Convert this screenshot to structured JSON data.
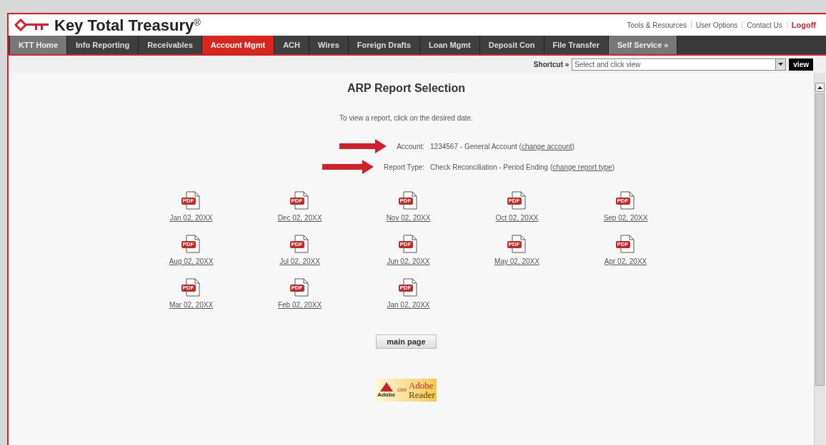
{
  "brand": {
    "name": "Key Total Treasury",
    "mark": "®"
  },
  "top_links": [
    {
      "label": "Tools & Resources",
      "kind": "link"
    },
    {
      "label": "User Options",
      "kind": "link"
    },
    {
      "label": "Contact Us",
      "kind": "link"
    },
    {
      "label": "Logoff",
      "kind": "logoff"
    }
  ],
  "tabs": [
    {
      "label": "KTT Home",
      "selected": false,
      "highlighted": true
    },
    {
      "label": "Info Reporting",
      "selected": false,
      "highlighted": false
    },
    {
      "label": "Receivables",
      "selected": false,
      "highlighted": false
    },
    {
      "label": "Account Mgmt",
      "selected": true,
      "highlighted": false
    },
    {
      "label": "ACH",
      "selected": false,
      "highlighted": false
    },
    {
      "label": "Wires",
      "selected": false,
      "highlighted": false
    },
    {
      "label": "Foreign Drafts",
      "selected": false,
      "highlighted": false
    },
    {
      "label": "Loan Mgmt",
      "selected": false,
      "highlighted": false
    },
    {
      "label": "Deposit Con",
      "selected": false,
      "highlighted": false
    },
    {
      "label": "File Transfer",
      "selected": false,
      "highlighted": false
    },
    {
      "label": "Self Service »",
      "selected": false,
      "highlighted": true
    }
  ],
  "shortcut": {
    "label": "Shortcut »",
    "value": "Select and click view",
    "button": "view"
  },
  "title": "ARP Report Selection",
  "instruction": "To view a report, click on the desired date.",
  "details": [
    {
      "label": "Account:",
      "value": "1234567 - General Account (",
      "link": "change account",
      "close": ")"
    },
    {
      "label": "Report Type:",
      "value": "Check Reconciliation - Period Ending (",
      "link": "change report type",
      "close": ")"
    }
  ],
  "reports": [
    {
      "icon_text": "PDF",
      "date": "Jan 02, 20XX"
    },
    {
      "icon_text": "PDF",
      "date": "Dec 02, 20XX"
    },
    {
      "icon_text": "PDF",
      "date": "Nov 02, 20XX"
    },
    {
      "icon_text": "PDF",
      "date": "Oct 02, 20XX"
    },
    {
      "icon_text": "PDF",
      "date": "Sep 02, 20XX"
    },
    {
      "icon_text": "PDF",
      "date": "Aug 02, 20XX"
    },
    {
      "icon_text": "PDF",
      "date": "Jul 02, 20XX"
    },
    {
      "icon_text": "PDF",
      "date": "Jun 02, 20XX"
    },
    {
      "icon_text": "PDF",
      "date": "May 02, 20XX"
    },
    {
      "icon_text": "PDF",
      "date": "Apr 02, 20XX"
    },
    {
      "icon_text": "PDF",
      "date": "Mar 02, 20XX"
    },
    {
      "icon_text": "PDF",
      "date": "Feb 02, 20XX"
    },
    {
      "icon_text": "PDF",
      "date": "Jan 02, 20XX"
    }
  ],
  "main_button": "main page",
  "adobe_badge": {
    "logo_caption": "Adobe",
    "get": "Get",
    "brand": "Adobe",
    "product": "Reader"
  }
}
